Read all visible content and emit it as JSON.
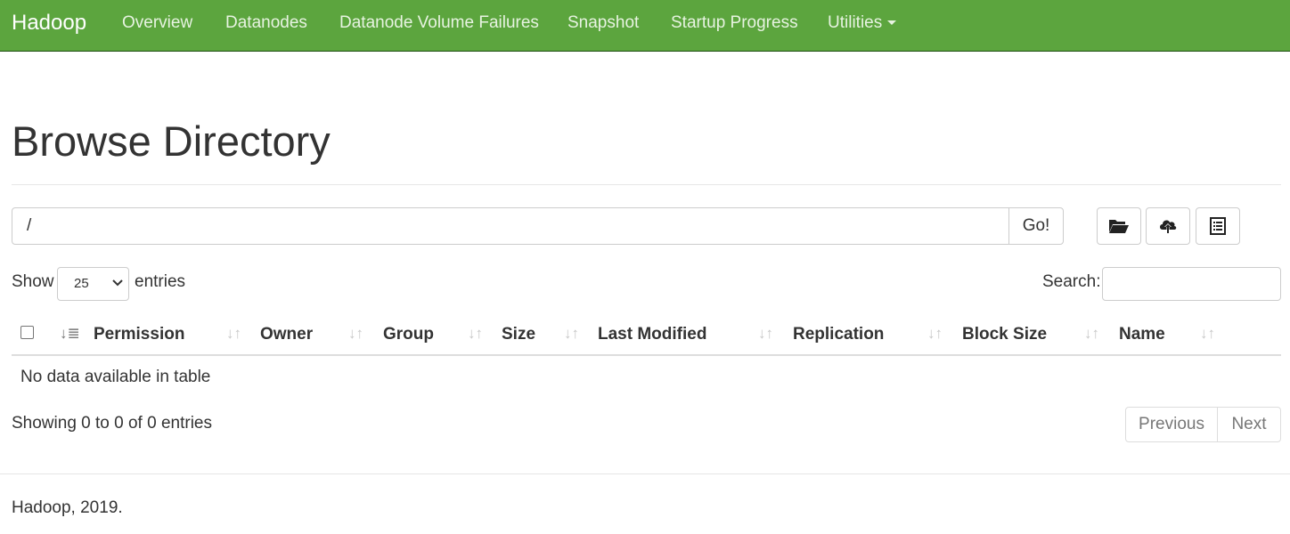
{
  "navbar": {
    "brand": "Hadoop",
    "items": [
      "Overview",
      "Datanodes",
      "Datanode Volume Failures",
      "Snapshot",
      "Startup Progress",
      "Utilities"
    ],
    "accent_color": "#5ca53e"
  },
  "page": {
    "title": "Browse Directory"
  },
  "pathbar": {
    "path_value": "/",
    "go_label": "Go!",
    "icons": [
      "folder-open-icon",
      "cloud-upload-icon",
      "list-alt-icon"
    ]
  },
  "table_controls": {
    "show_label": "Show",
    "page_size": "25",
    "entries_label": "entries",
    "search_label": "Search:",
    "search_value": ""
  },
  "table": {
    "columns": [
      "Permission",
      "Owner",
      "Group",
      "Size",
      "Last Modified",
      "Replication",
      "Block Size",
      "Name"
    ],
    "empty_message": "No data available in table",
    "info": "Showing 0 to 0 of 0 entries",
    "previous_label": "Previous",
    "next_label": "Next"
  },
  "footer": {
    "text": "Hadoop, 2019."
  }
}
